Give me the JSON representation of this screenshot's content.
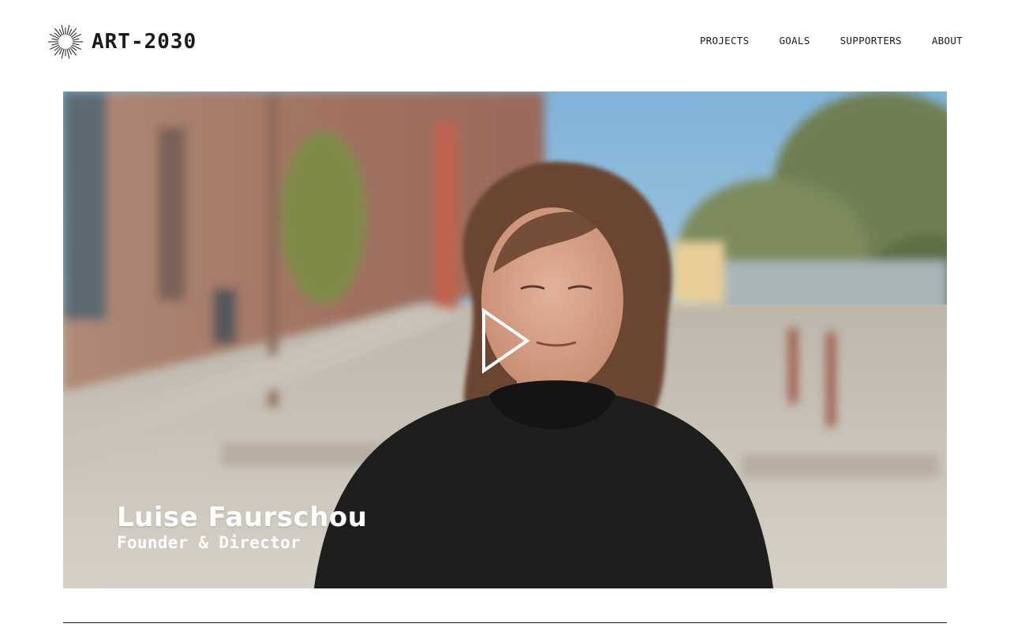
{
  "brand": {
    "name": "ART-2030",
    "logo_icon": "sunburst-icon"
  },
  "nav": {
    "items": [
      {
        "label": "PROJECTS"
      },
      {
        "label": "GOALS"
      },
      {
        "label": "SUPPORTERS"
      },
      {
        "label": "ABOUT"
      }
    ]
  },
  "video": {
    "play_icon": "play-icon",
    "caption": {
      "name": "Luise Faurschou",
      "role": "Founder & Director"
    }
  }
}
